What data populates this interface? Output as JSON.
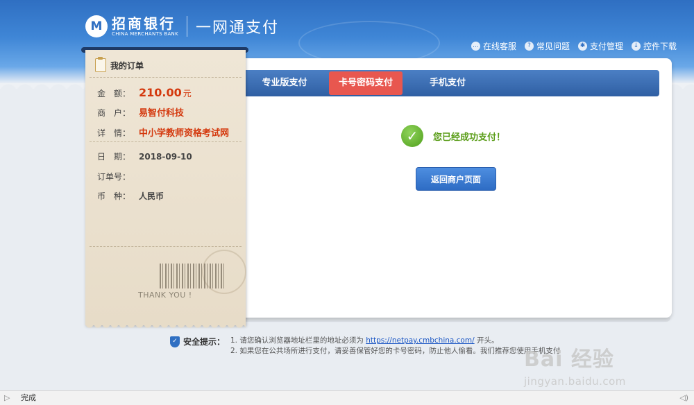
{
  "brand": {
    "logo_mark": "M",
    "name_cn": "招商银行",
    "name_en": "CHINA MERCHANTS BANK",
    "slogan": "一网通支付"
  },
  "top_links": [
    {
      "label": "在线客服",
      "icon": "chat-icon"
    },
    {
      "label": "常见问题",
      "icon": "question-icon"
    },
    {
      "label": "支付管理",
      "icon": "gear-icon"
    },
    {
      "label": "控件下载",
      "icon": "download-icon"
    }
  ],
  "tabs": [
    {
      "label": "专业版支付",
      "active": false
    },
    {
      "label": "卡号密码支付",
      "active": true
    },
    {
      "label": "手机支付",
      "active": false
    }
  ],
  "result": {
    "message": "您已经成功支付！",
    "return_button": "返回商户页面"
  },
  "order": {
    "title": "我的订单",
    "amount_label": "金　额：",
    "amount": "210.00",
    "currency_unit": "元",
    "merchant_label": "商　户：",
    "merchant": "易智付科技",
    "detail_label": "详　情：",
    "detail": "中小学教师资格考试网",
    "date_label": "日　期：",
    "date": "2018-09-10",
    "order_no_label": "订单号：",
    "order_no": "",
    "currency_label": "币　种：",
    "currency": "人民币",
    "thanks": "THANK YOU !"
  },
  "tips": {
    "title": "安全提示：",
    "line1_pre": "1. 请您确认浏览器地址栏里的地址必须为 ",
    "line1_link": "https://netpay.cmbchina.com/",
    "line1_post": " 开头。",
    "line2": "2. 如果您在公共场所进行支付，请妥善保管好您的卡号密码，防止他人偷看。我们推荐您使用手机支付"
  },
  "watermark": {
    "main": "Bai 经验",
    "sub": "jingyan.baidu.com"
  },
  "status_bar": {
    "text": "完成"
  }
}
